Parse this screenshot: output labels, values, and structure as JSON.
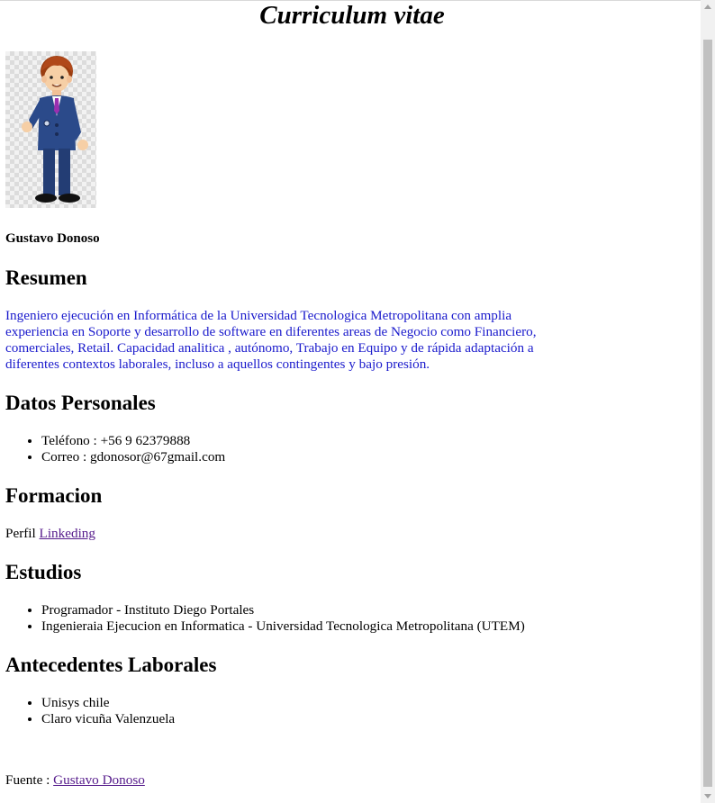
{
  "page": {
    "title": "Curriculum vitae",
    "name": "Gustavo Donoso"
  },
  "photo": {
    "icon": "cartoon-businessman-avatar"
  },
  "sections": {
    "resumen": {
      "heading": "Resumen",
      "text": "Ingeniero ejecución en Informática de la Universidad Tecnologica Metropolitana con amplia experiencia en Soporte y desarrollo de software en diferentes areas de Negocio como Financiero, comerciales, Retail. Capacidad analitica , autónomo, Trabajo en Equipo y de rápida adaptación a diferentes contextos laborales, incluso a aquellos contingentes y bajo presión.",
      "text_color": "#1a1acc"
    },
    "datos": {
      "heading": "Datos Personales",
      "items": [
        "Teléfono : +56 9 62379888",
        "Correo : gdonosor@67gmail.com"
      ]
    },
    "formacion": {
      "heading": "Formacion",
      "prefix": "Perfil",
      "link_label": "Linkeding"
    },
    "estudios": {
      "heading": "Estudios",
      "items": [
        "Programador - Instituto Diego Portales",
        "Ingenieraia Ejecucion en Informatica - Universidad Tecnologica Metropolitana (UTEM)"
      ]
    },
    "laborales": {
      "heading": "Antecedentes Laborales",
      "items": [
        "Unisys chile",
        "Claro vicuña Valenzuela"
      ]
    }
  },
  "footer": {
    "prefix": "Fuente :",
    "link_label": "Gustavo Donoso"
  },
  "colors": {
    "link": "#551a8b",
    "summary": "#1a1acc"
  }
}
